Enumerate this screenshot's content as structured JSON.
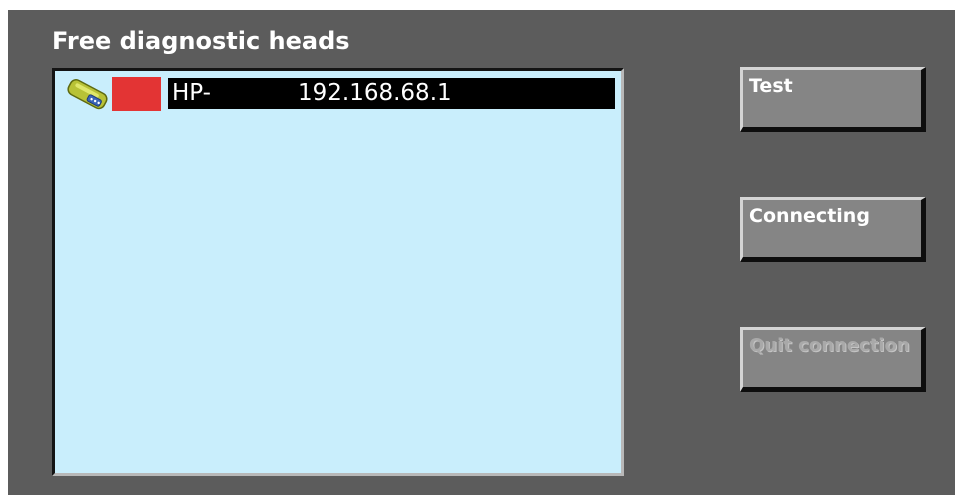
{
  "panel": {
    "title": "Free diagnostic heads"
  },
  "heads": [
    {
      "name": "HP-",
      "ip": "192.168.68.1",
      "icon": "diagnostic-head-icon",
      "status_color": "#e33434",
      "selected": true
    }
  ],
  "buttons": {
    "test_label": "Test",
    "connecting_label": "Connecting",
    "quit_label": "Quit connection",
    "quit_enabled": false
  },
  "colors": {
    "background": "#5c5c5c",
    "list_background": "#c9eefc",
    "selection": "#000000",
    "button": "#858585"
  }
}
